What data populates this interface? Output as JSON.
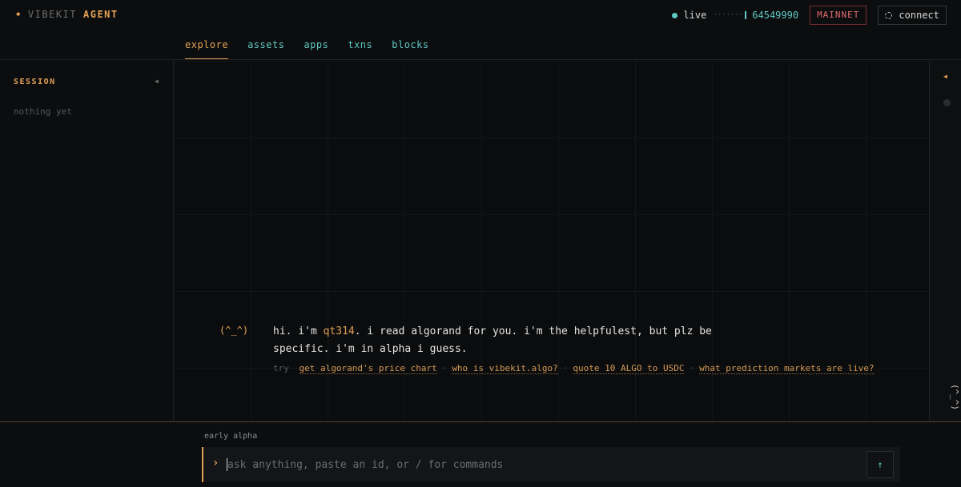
{
  "brand": {
    "name_part1": "VIBEKIT",
    "name_part2": "AGENT",
    "icon": "diamond-icon"
  },
  "status": {
    "live_label": "live",
    "block_number": "64549990",
    "network": "MAINNET",
    "connect_label": "connect"
  },
  "nav": {
    "tabs": [
      {
        "label": "explore",
        "active": true
      },
      {
        "label": "assets",
        "active": false
      },
      {
        "label": "apps",
        "active": false
      },
      {
        "label": "txns",
        "active": false
      },
      {
        "label": "blocks",
        "active": false
      }
    ]
  },
  "sidebar": {
    "title": "SESSION",
    "empty_text": "nothing yet"
  },
  "chat": {
    "mascot": "(^_^)",
    "greeting_pre": "hi. i'm ",
    "greeting_name": "qt314",
    "greeting_post": ". i read algorand for you. i'm the helpfulest, but plz be specific. i'm in alpha i guess.",
    "try_label": "try",
    "suggestions": [
      "get algorand's price chart",
      "who is vibekit.algo?",
      "quote 10 ALGO to USDC",
      "what prediction markets are live?"
    ],
    "separator": "·"
  },
  "rail": {
    "face": "(^_^)"
  },
  "composer": {
    "stage_label": "early alpha",
    "placeholder": "ask anything, paste an id, or / for commands",
    "send_icon": "arrow-up-icon"
  },
  "colors": {
    "accent": "#e2a255",
    "teal": "#5fc9c2",
    "network_red": "#e06a6f",
    "background": "#0c0d0f"
  }
}
